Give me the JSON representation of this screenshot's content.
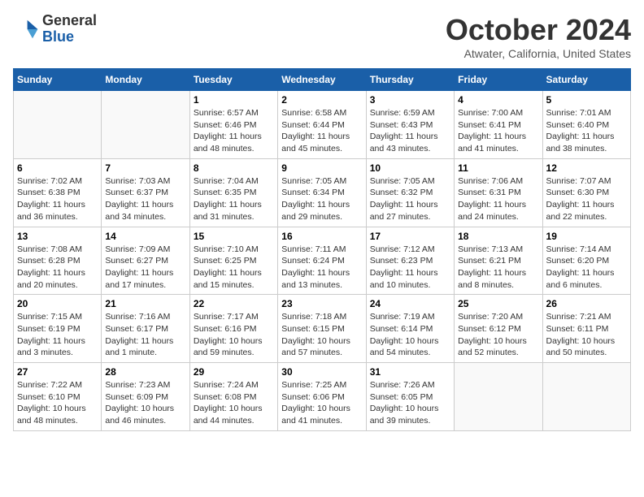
{
  "header": {
    "logo_line1": "General",
    "logo_line2": "Blue",
    "month_title": "October 2024",
    "location": "Atwater, California, United States"
  },
  "days_of_week": [
    "Sunday",
    "Monday",
    "Tuesday",
    "Wednesday",
    "Thursday",
    "Friday",
    "Saturday"
  ],
  "weeks": [
    [
      {
        "day": "",
        "text": ""
      },
      {
        "day": "",
        "text": ""
      },
      {
        "day": "1",
        "text": "Sunrise: 6:57 AM\nSunset: 6:46 PM\nDaylight: 11 hours and 48 minutes."
      },
      {
        "day": "2",
        "text": "Sunrise: 6:58 AM\nSunset: 6:44 PM\nDaylight: 11 hours and 45 minutes."
      },
      {
        "day": "3",
        "text": "Sunrise: 6:59 AM\nSunset: 6:43 PM\nDaylight: 11 hours and 43 minutes."
      },
      {
        "day": "4",
        "text": "Sunrise: 7:00 AM\nSunset: 6:41 PM\nDaylight: 11 hours and 41 minutes."
      },
      {
        "day": "5",
        "text": "Sunrise: 7:01 AM\nSunset: 6:40 PM\nDaylight: 11 hours and 38 minutes."
      }
    ],
    [
      {
        "day": "6",
        "text": "Sunrise: 7:02 AM\nSunset: 6:38 PM\nDaylight: 11 hours and 36 minutes."
      },
      {
        "day": "7",
        "text": "Sunrise: 7:03 AM\nSunset: 6:37 PM\nDaylight: 11 hours and 34 minutes."
      },
      {
        "day": "8",
        "text": "Sunrise: 7:04 AM\nSunset: 6:35 PM\nDaylight: 11 hours and 31 minutes."
      },
      {
        "day": "9",
        "text": "Sunrise: 7:05 AM\nSunset: 6:34 PM\nDaylight: 11 hours and 29 minutes."
      },
      {
        "day": "10",
        "text": "Sunrise: 7:05 AM\nSunset: 6:32 PM\nDaylight: 11 hours and 27 minutes."
      },
      {
        "day": "11",
        "text": "Sunrise: 7:06 AM\nSunset: 6:31 PM\nDaylight: 11 hours and 24 minutes."
      },
      {
        "day": "12",
        "text": "Sunrise: 7:07 AM\nSunset: 6:30 PM\nDaylight: 11 hours and 22 minutes."
      }
    ],
    [
      {
        "day": "13",
        "text": "Sunrise: 7:08 AM\nSunset: 6:28 PM\nDaylight: 11 hours and 20 minutes."
      },
      {
        "day": "14",
        "text": "Sunrise: 7:09 AM\nSunset: 6:27 PM\nDaylight: 11 hours and 17 minutes."
      },
      {
        "day": "15",
        "text": "Sunrise: 7:10 AM\nSunset: 6:25 PM\nDaylight: 11 hours and 15 minutes."
      },
      {
        "day": "16",
        "text": "Sunrise: 7:11 AM\nSunset: 6:24 PM\nDaylight: 11 hours and 13 minutes."
      },
      {
        "day": "17",
        "text": "Sunrise: 7:12 AM\nSunset: 6:23 PM\nDaylight: 11 hours and 10 minutes."
      },
      {
        "day": "18",
        "text": "Sunrise: 7:13 AM\nSunset: 6:21 PM\nDaylight: 11 hours and 8 minutes."
      },
      {
        "day": "19",
        "text": "Sunrise: 7:14 AM\nSunset: 6:20 PM\nDaylight: 11 hours and 6 minutes."
      }
    ],
    [
      {
        "day": "20",
        "text": "Sunrise: 7:15 AM\nSunset: 6:19 PM\nDaylight: 11 hours and 3 minutes."
      },
      {
        "day": "21",
        "text": "Sunrise: 7:16 AM\nSunset: 6:17 PM\nDaylight: 11 hours and 1 minute."
      },
      {
        "day": "22",
        "text": "Sunrise: 7:17 AM\nSunset: 6:16 PM\nDaylight: 10 hours and 59 minutes."
      },
      {
        "day": "23",
        "text": "Sunrise: 7:18 AM\nSunset: 6:15 PM\nDaylight: 10 hours and 57 minutes."
      },
      {
        "day": "24",
        "text": "Sunrise: 7:19 AM\nSunset: 6:14 PM\nDaylight: 10 hours and 54 minutes."
      },
      {
        "day": "25",
        "text": "Sunrise: 7:20 AM\nSunset: 6:12 PM\nDaylight: 10 hours and 52 minutes."
      },
      {
        "day": "26",
        "text": "Sunrise: 7:21 AM\nSunset: 6:11 PM\nDaylight: 10 hours and 50 minutes."
      }
    ],
    [
      {
        "day": "27",
        "text": "Sunrise: 7:22 AM\nSunset: 6:10 PM\nDaylight: 10 hours and 48 minutes."
      },
      {
        "day": "28",
        "text": "Sunrise: 7:23 AM\nSunset: 6:09 PM\nDaylight: 10 hours and 46 minutes."
      },
      {
        "day": "29",
        "text": "Sunrise: 7:24 AM\nSunset: 6:08 PM\nDaylight: 10 hours and 44 minutes."
      },
      {
        "day": "30",
        "text": "Sunrise: 7:25 AM\nSunset: 6:06 PM\nDaylight: 10 hours and 41 minutes."
      },
      {
        "day": "31",
        "text": "Sunrise: 7:26 AM\nSunset: 6:05 PM\nDaylight: 10 hours and 39 minutes."
      },
      {
        "day": "",
        "text": ""
      },
      {
        "day": "",
        "text": ""
      }
    ]
  ]
}
